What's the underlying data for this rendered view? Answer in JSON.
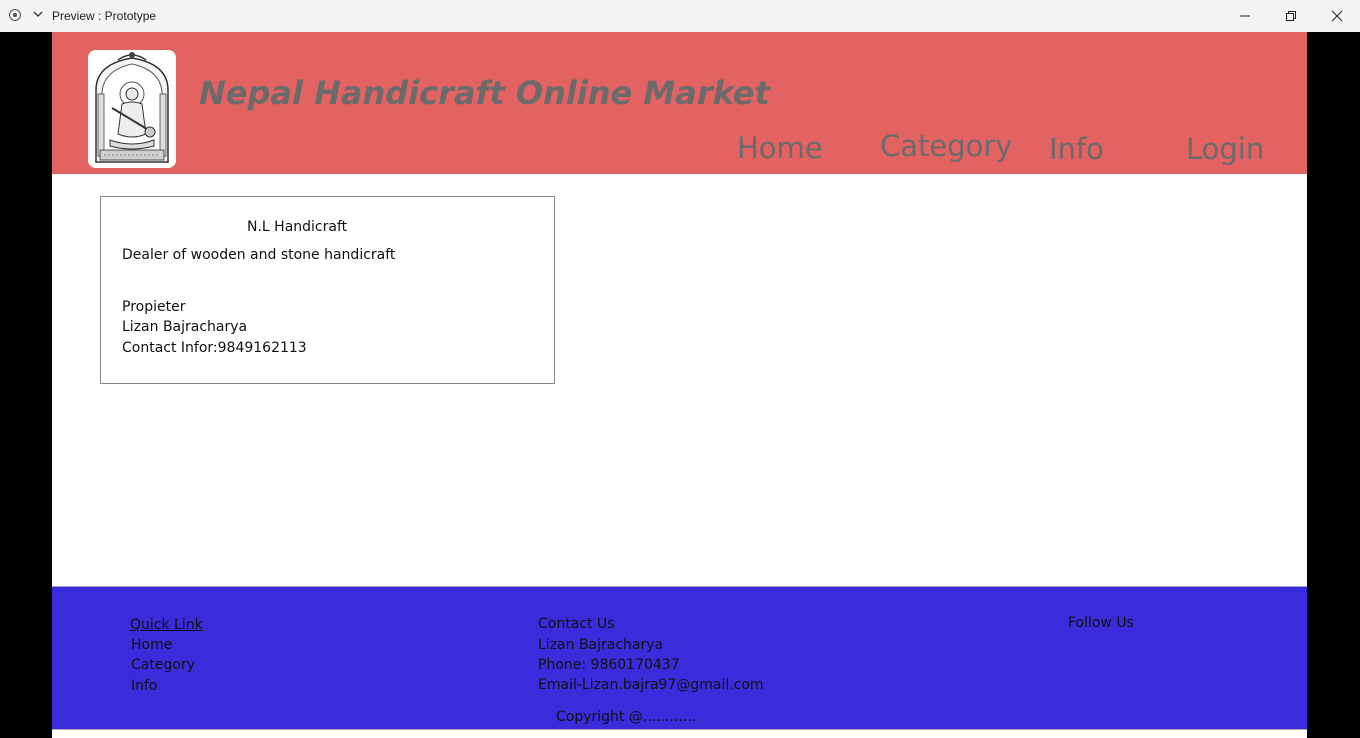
{
  "window": {
    "title": "Preview : Prototype",
    "controls": [
      "minimize-icon",
      "restore-icon",
      "close-icon"
    ]
  },
  "header": {
    "site_title": "Nepal Handicraft Online Market",
    "nav": {
      "home": "Home",
      "category": "Category",
      "info": "Info",
      "login": "Login"
    },
    "colors": {
      "background": "#e36363",
      "text": "#6b6b6b"
    }
  },
  "card": {
    "title": "N.L Handicraft",
    "description": "Dealer of wooden and stone handicraft",
    "proprietor_label": "Propieter",
    "proprietor_name": "Lizan Bajracharya",
    "contact": "Contact Infor:9849162113"
  },
  "footer": {
    "quick_link_title": "Quick Link",
    "quick_links": {
      "home": "Home",
      "category": "Category",
      "info": "Info"
    },
    "contact_title": "Contact Us",
    "contact_name": "Lizan Bajracharya",
    "contact_phone": "Phone: 9860170437",
    "contact_email": "Email-Lizan.bajra97@gmail.com",
    "follow_title": "Follow Us",
    "copyright": "Copyright @............",
    "colors": {
      "background": "#3a2bdb"
    }
  }
}
